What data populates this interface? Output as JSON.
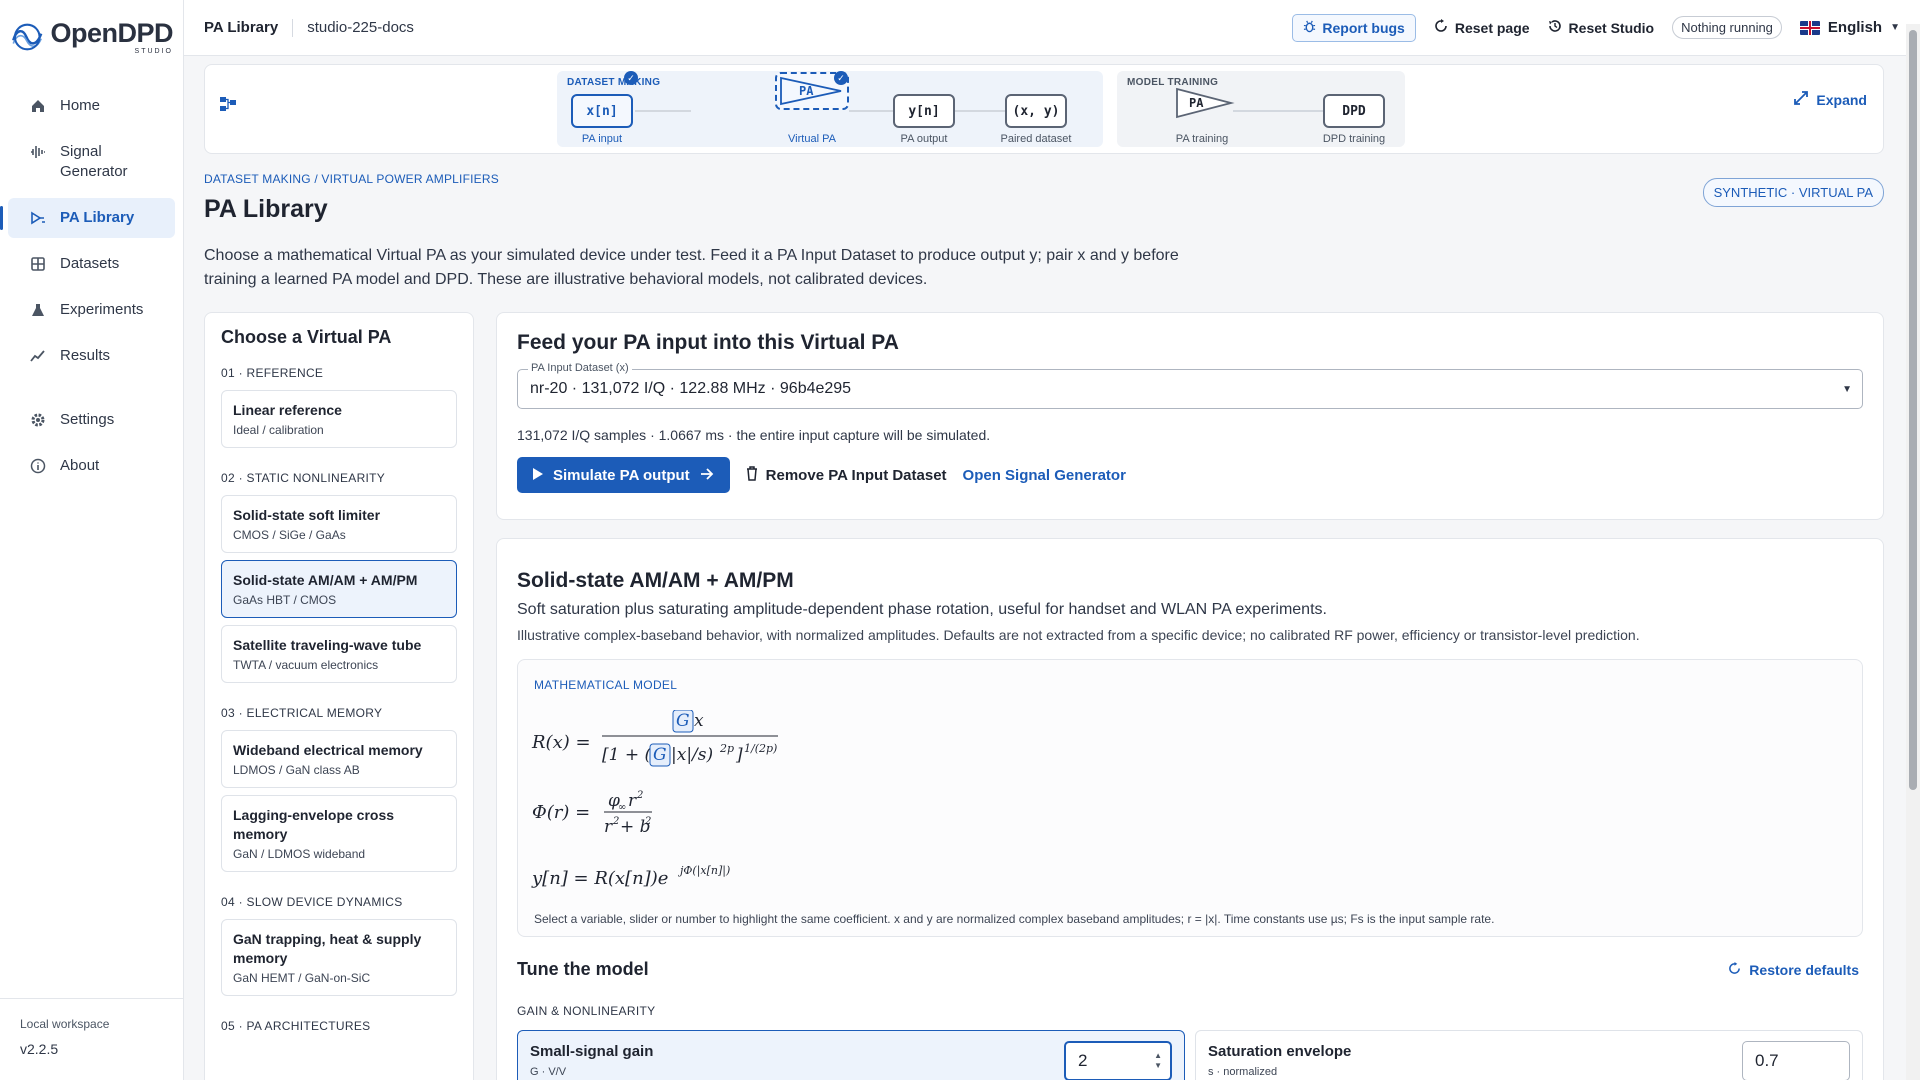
{
  "app": {
    "brand": "OpenDPD",
    "brand_sub": "STUDIO"
  },
  "sidebar": {
    "items": [
      {
        "label": "Home",
        "icon": "home-icon"
      },
      {
        "label": "Signal Generator",
        "icon": "waveform-icon"
      },
      {
        "label": "PA Library",
        "icon": "amplifier-icon"
      },
      {
        "label": "Datasets",
        "icon": "grid-icon"
      },
      {
        "label": "Experiments",
        "icon": "flask-icon"
      },
      {
        "label": "Results",
        "icon": "trend-icon"
      },
      {
        "label": "Settings",
        "icon": "gear-icon"
      },
      {
        "label": "About",
        "icon": "info-icon"
      }
    ],
    "workspace": "Local workspace",
    "version": "v2.2.5"
  },
  "topbar": {
    "title": "PA Library",
    "workspace": "studio-225-docs",
    "report": "Report bugs",
    "reset_page": "Reset page",
    "reset_studio": "Reset Studio",
    "status": "Nothing running",
    "language": "English"
  },
  "pipeline": {
    "stage1": "DATASET MAKING",
    "stage2": "MODEL TRAINING",
    "nodes": [
      {
        "text": "x[n]",
        "label": "PA input"
      },
      {
        "text": "PA",
        "label": "Virtual PA"
      },
      {
        "text": "y[n]",
        "label": "PA output"
      },
      {
        "text": "(x, y)",
        "label": "Paired dataset"
      },
      {
        "text": "PA",
        "label": "PA training"
      },
      {
        "text": "DPD",
        "label": "DPD training"
      }
    ],
    "expand": "Expand"
  },
  "page": {
    "crumb": "DATASET MAKING / VIRTUAL POWER AMPLIFIERS",
    "title": "PA Library",
    "badge": "SYNTHETIC · VIRTUAL PA",
    "intro": "Choose a mathematical Virtual PA as your simulated device under test. Feed it a PA Input Dataset to produce output y; pair x and y before training a learned PA model and DPD. These are illustrative behavioral models, not calibrated devices."
  },
  "pa_list": {
    "title": "Choose a Virtual PA",
    "groups": [
      {
        "label": "01 · REFERENCE",
        "items": [
          {
            "name": "Linear reference",
            "tag": "Ideal / calibration"
          }
        ]
      },
      {
        "label": "02 · STATIC NONLINEARITY",
        "items": [
          {
            "name": "Solid-state soft limiter",
            "tag": "CMOS / SiGe / GaAs"
          },
          {
            "name": "Solid-state AM/AM + AM/PM",
            "tag": "GaAs HBT / CMOS"
          },
          {
            "name": "Satellite traveling-wave tube",
            "tag": "TWTA / vacuum electronics"
          }
        ]
      },
      {
        "label": "03 · ELECTRICAL MEMORY",
        "items": [
          {
            "name": "Wideband electrical memory",
            "tag": "LDMOS / GaN class AB"
          },
          {
            "name": "Lagging-envelope cross memory",
            "tag": "GaN / LDMOS wideband"
          }
        ]
      },
      {
        "label": "04 · SLOW DEVICE DYNAMICS",
        "items": [
          {
            "name": "GaN trapping, heat & supply memory",
            "tag": "GaN HEMT / GaN-on-SiC"
          }
        ]
      },
      {
        "label": "05 · PA ARCHITECTURES",
        "items": []
      }
    ]
  },
  "feed": {
    "title": "Feed your PA input into this Virtual PA",
    "field_label": "PA Input Dataset (x)",
    "field_value": "nr-20 · 131,072 I/Q · 122.88 MHz · 96b4e295",
    "samples": "131,072 I/Q samples · 1.0667 ms · the entire input capture will be simulated.",
    "simulate": "Simulate PA output",
    "remove": "Remove PA Input Dataset",
    "open_gen": "Open Signal Generator"
  },
  "model": {
    "title": "Solid-state AM/AM + AM/PM",
    "desc": "Soft saturation plus saturating amplitude-dependent phase rotation, useful for handset and WLAN PA experiments.",
    "note": "Illustrative complex-baseband behavior, with normalized amplitudes. Defaults are not extracted from a specific device; no calibrated RF power, efficiency or transistor-level prediction.",
    "math_title": "MATHEMATICAL MODEL",
    "math_foot": "Select a variable, slider or number to highlight the same coefficient. x and y are normalized complex baseband amplitudes; r = |x|. Time constants use µs; Fs is the input sample rate.",
    "tune": "Tune the model",
    "restore": "Restore defaults",
    "group": "GAIN & NONLINEARITY",
    "params": [
      {
        "name": "Small-signal gain",
        "unit": "G · V/V",
        "value": "2"
      },
      {
        "name": "Saturation envelope",
        "unit": "s · normalized",
        "value": "0.7"
      }
    ]
  }
}
